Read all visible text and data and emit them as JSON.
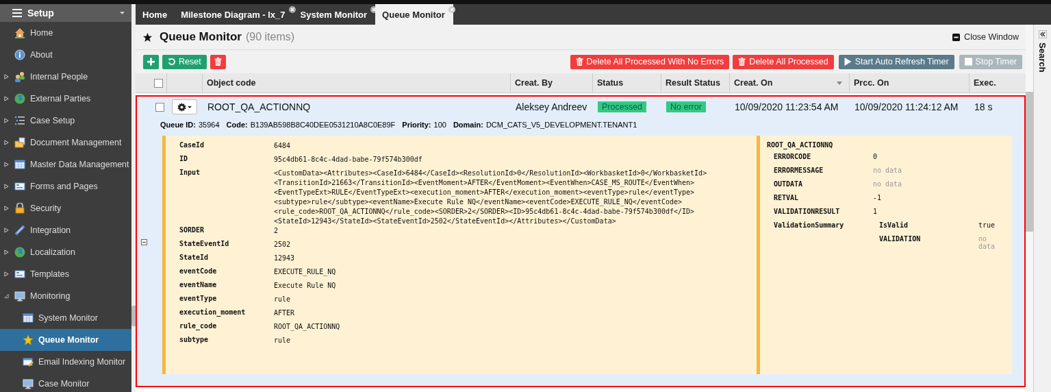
{
  "sidebar": {
    "title": "Setup",
    "items": [
      {
        "label": "Home",
        "selected": false
      },
      {
        "label": "About",
        "selected": false
      },
      {
        "label": "Internal People",
        "expanded": false,
        "selected": false
      },
      {
        "label": "External Parties",
        "expanded": false,
        "selected": false
      },
      {
        "label": "Case Setup",
        "expanded": false,
        "selected": false
      },
      {
        "label": "Document Management",
        "expanded": false,
        "selected": false
      },
      {
        "label": "Master Data Management",
        "expanded": false,
        "selected": false
      },
      {
        "label": "Forms and Pages",
        "expanded": false,
        "selected": false
      },
      {
        "label": "Security",
        "expanded": false,
        "selected": false
      },
      {
        "label": "Integration",
        "expanded": false,
        "selected": false
      },
      {
        "label": "Localization",
        "expanded": false,
        "selected": false
      },
      {
        "label": "Templates",
        "expanded": false,
        "selected": false
      },
      {
        "label": "Monitoring",
        "expanded": true,
        "selected": false,
        "children": [
          {
            "label": "System Monitor",
            "selected": false
          },
          {
            "label": "Queue Monitor",
            "selected": true
          },
          {
            "label": "Email Indexing Monitor",
            "selected": false
          },
          {
            "label": "Case Monitor",
            "selected": false
          }
        ]
      }
    ]
  },
  "tabs": [
    {
      "label": "Home",
      "closable": false,
      "selected": false
    },
    {
      "label": "Milestone Diagram - lx_7",
      "closable": true,
      "selected": false
    },
    {
      "label": "System Monitor",
      "closable": true,
      "selected": false
    },
    {
      "label": "Queue Monitor",
      "closable": true,
      "selected": true
    }
  ],
  "page": {
    "title": "Queue Monitor",
    "count": "(90 items)",
    "close": "Close Window"
  },
  "toolbar": {
    "reset": "Reset",
    "delete_no_errors": "Delete All Processed With No Errors",
    "delete_processed": "Delete All Processed",
    "start_timer": "Start Auto Refresh Timer",
    "stop_timer": "Stop Timer",
    "stop_timer_disabled": true
  },
  "search_panel": "Search",
  "table": {
    "columns": [
      {
        "label": "Object code",
        "sorted": false
      },
      {
        "label": "Creat. By",
        "sorted": false
      },
      {
        "label": "Status",
        "sorted": false
      },
      {
        "label": "Result Status",
        "sorted": false
      },
      {
        "label": "Creat. On",
        "sorted": true
      },
      {
        "label": "Prcc. On",
        "sorted": false
      },
      {
        "label": "Exec.",
        "sorted": false
      }
    ],
    "header_checked": false,
    "rows": [
      {
        "checked": false,
        "expanded": true,
        "object_code": "ROOT_QA_ACTIONNQ",
        "created_by": "Aleksey Andreev",
        "status": "Processed",
        "result_status": "No error",
        "created_on": "10/09/2020 11:23:54 AM",
        "processed_on": "10/09/2020 11:24:12 AM",
        "exec": "18 s",
        "meta": [
          {
            "label": "Queue ID:",
            "value": "35964"
          },
          {
            "label": "Code:",
            "value": "B139AB598B8C40DEE0531210A8C0E89F"
          },
          {
            "label": "Priority:",
            "value": "100"
          },
          {
            "label": "Domain:",
            "value": "DCM_CATS_V5_DEVELOPMENT.TENANT1"
          }
        ],
        "input_fields": [
          {
            "name": "CaseId",
            "value": "6484"
          },
          {
            "name": "ID",
            "value": "95c4db61-8c4c-4dad-babe-79f574b300df"
          },
          {
            "name": "Input",
            "value": "<CustomData><Attributes><CaseId>6484</CaseId><ResolutionId>0</ResolutionId><WorkbasketId>0</WorkbasketId>\n<TransitionId>21663</TransitionId><EventMoment>AFTER</EventMoment><EventWhen>CASE_MS_ROUTE</EventWhen>\n<EventTypeExt>RULE</EventTypeExt><execution_moment>AFTER</execution_moment><eventType>rule</eventType>\n<subtype>rule</subtype><eventName>Execute Rule NQ</eventName><eventCode>EXECUTE_RULE_NQ</eventCode>\n<rule_code>ROOT_QA_ACTIONNQ</rule_code><SORDER>2</SORDER><ID>95c4db61-8c4c-4dad-babe-79f574b300df</ID>\n<StateId>12943</StateId><StateEventId>2502</StateEventId></Attributes></CustomData>"
          },
          {
            "name": "SORDER",
            "value": "2"
          },
          {
            "name": "StateEventId",
            "value": "2502"
          },
          {
            "name": "StateId",
            "value": "12943"
          },
          {
            "name": "eventCode",
            "value": "EXECUTE_RULE_NQ"
          },
          {
            "name": "eventName",
            "value": "Execute Rule NQ"
          },
          {
            "name": "eventType",
            "value": "rule"
          },
          {
            "name": "execution_moment",
            "value": "AFTER"
          },
          {
            "name": "rule_code",
            "value": "ROOT_QA_ACTIONNQ"
          },
          {
            "name": "subtype",
            "value": "rule"
          }
        ],
        "output": {
          "title": "ROOT_QA_ACTIONNQ",
          "fields": [
            {
              "name": "ERRORCODE",
              "value": "0",
              "empty": false
            },
            {
              "name": "ERRORMESSAGE",
              "value": "no data",
              "empty": true
            },
            {
              "name": "OUTDATA",
              "value": "no data",
              "empty": true
            },
            {
              "name": "RETVAL",
              "value": "-1",
              "empty": false
            },
            {
              "name": "VALIDATIONRESULT",
              "value": "1",
              "empty": false
            },
            {
              "name": "ValidationSummary",
              "children": [
                {
                  "name": "IsValid",
                  "value": "true",
                  "empty": false
                },
                {
                  "name": "VALIDATION",
                  "value": "no data",
                  "empty": true
                }
              ]
            }
          ]
        }
      }
    ]
  }
}
